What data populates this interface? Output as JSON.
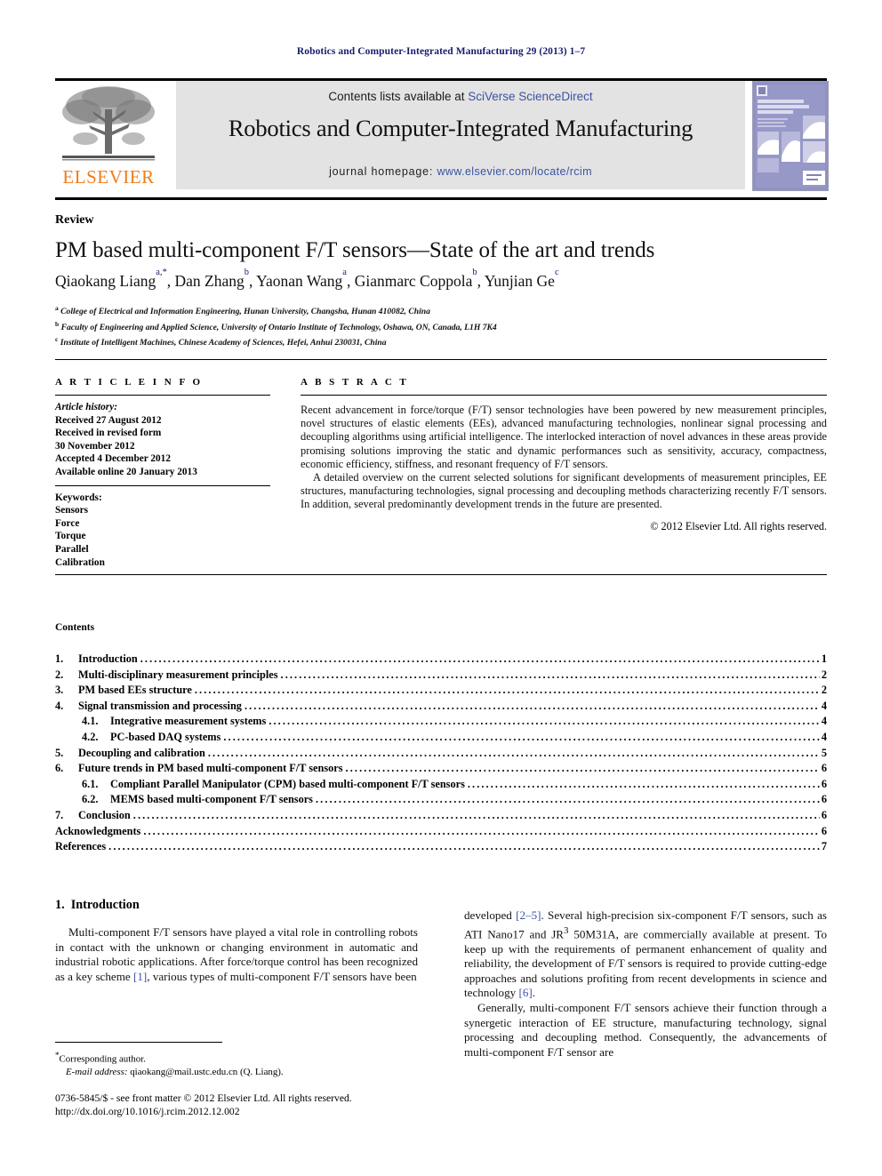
{
  "running_head": "Robotics and Computer-Integrated Manufacturing 29 (2013) 1–7",
  "masthead": {
    "contents_prefix": "Contents lists available at ",
    "sciencedirect": "SciVerse ScienceDirect",
    "journal_title": "Robotics and Computer-Integrated Manufacturing",
    "homepage_prefix": "journal homepage: ",
    "homepage_url": "www.elsevier.com/locate/rcim",
    "publisher": "ELSEVIER",
    "cover_title": "Robotics and Computer-Integrated Manufacturing",
    "accent_blue": "#3a53a4",
    "elsevier_orange": "#ef7d1a",
    "cover_purple": "#8e8fc0"
  },
  "article": {
    "type": "Review",
    "title": "PM based multi-component F/T sensors—State of the art and trends",
    "authors": [
      {
        "name": "Qiaokang Liang",
        "marks": "a,*"
      },
      {
        "name": "Dan Zhang",
        "marks": "b"
      },
      {
        "name": "Yaonan Wang",
        "marks": "a"
      },
      {
        "name": "Gianmarc Coppola",
        "marks": "b"
      },
      {
        "name": "Yunjian Ge",
        "marks": "c"
      }
    ],
    "affiliations": [
      {
        "mark": "a",
        "text": "College of Electrical and Information Engineering, Hunan University, Changsha, Hunan 410082, China"
      },
      {
        "mark": "b",
        "text": "Faculty of Engineering and Applied Science, University of Ontario Institute of Technology, Oshawa, ON, Canada, L1H 7K4"
      },
      {
        "mark": "c",
        "text": "Institute of Intelligent Machines, Chinese Academy of Sciences, Hefei, Anhui 230031, China"
      }
    ]
  },
  "article_info": {
    "heading": "A R T I C L E   I N F O",
    "history_label": "Article history:",
    "history": [
      "Received 27 August 2012",
      "Received in revised form",
      "30 November 2012",
      "Accepted 4 December 2012",
      "Available online 20 January 2013"
    ],
    "keywords_label": "Keywords:",
    "keywords": [
      "Sensors",
      "Force",
      "Torque",
      "Parallel",
      "Calibration"
    ]
  },
  "abstract": {
    "heading": "A B S T R A C T",
    "paragraphs": [
      "Recent advancement in force/torque (F/T) sensor technologies have been powered by new measurement principles, novel structures of elastic elements (EEs), advanced manufacturing technologies, nonlinear signal processing and decoupling algorithms using artificial intelligence. The interlocked interaction of novel advances in these areas provide promising solutions improving the static and dynamic performances such as sensitivity, accuracy, compactness, economic efficiency, stiffness, and resonant frequency of F/T sensors.",
      "A detailed overview on the current selected solutions for significant developments of measurement principles, EE structures, manufacturing technologies, signal processing and decoupling methods characterizing recently F/T sensors. In addition, several predominantly development trends in the future are presented."
    ],
    "copyright": "© 2012 Elsevier Ltd. All rights reserved."
  },
  "contents": {
    "heading": "Contents",
    "entries": [
      {
        "num": "1.",
        "label": "Introduction",
        "page": "1",
        "level": 0
      },
      {
        "num": "2.",
        "label": "Multi-disciplinary measurement principles",
        "page": "2",
        "level": 0
      },
      {
        "num": "3.",
        "label": "PM based EEs structure",
        "page": "2",
        "level": 0
      },
      {
        "num": "4.",
        "label": "Signal transmission and processing",
        "page": "4",
        "level": 0
      },
      {
        "num": "4.1.",
        "label": "Integrative measurement systems",
        "page": "4",
        "level": 1
      },
      {
        "num": "4.2.",
        "label": "PC-based DAQ systems",
        "page": "4",
        "level": 1
      },
      {
        "num": "5.",
        "label": "Decoupling and calibration",
        "page": "5",
        "level": 0
      },
      {
        "num": "6.",
        "label": "Future trends in PM based multi-component F/T sensors",
        "page": "6",
        "level": 0
      },
      {
        "num": "6.1.",
        "label": "Compliant Parallel Manipulator (CPM) based multi-component F/T sensors",
        "page": "6",
        "level": 1
      },
      {
        "num": "6.2.",
        "label": "MEMS based multi-component F/T sensors",
        "page": "6",
        "level": 1
      },
      {
        "num": "7.",
        "label": "Conclusion",
        "page": "6",
        "level": 0
      },
      {
        "num": "",
        "label": "Acknowledgments",
        "page": "6",
        "level": 0
      },
      {
        "num": "",
        "label": "References",
        "page": "7",
        "level": 0
      }
    ]
  },
  "body": {
    "section_number": "1.",
    "section_title": "Introduction",
    "left_paragraph_1": "Multi-component F/T sensors have played a vital role in controlling robots in contact with the unknown or changing environment in automatic and industrial robotic applications. After force/torque control has been recognized as a key scheme",
    "left_ref_1": "[1]",
    "left_paragraph_1_tail": ", various types of multi-component F/T sensors have been",
    "right_paragraph_1_head": "developed ",
    "right_ref_1": "[2–5]",
    "right_paragraph_1": ". Several high-precision six-component F/T sensors, such as ATI Nano17 and JR",
    "right_sup": "3",
    "right_paragraph_1b": " 50M31A, are commercially available at present. To keep up with the requirements of permanent enhancement of quality and reliability, the development of F/T sensors is required to provide cutting-edge approaches and solutions profiting from recent developments in science and technology ",
    "right_ref_2": "[6]",
    "right_paragraph_1c": ".",
    "right_paragraph_2": "Generally, multi-component F/T sensors achieve their function through a synergetic interaction of EE structure, manufacturing technology, signal processing and decoupling method. Consequently, the advancements of multi-component F/T sensor are"
  },
  "footer": {
    "corresponding_marker": "*",
    "corresponding_label": "Corresponding author.",
    "email_label": "E-mail address:",
    "email": "qiaokang@mail.ustc.edu.cn (Q. Liang).",
    "issn_line": "0736-5845/$ - see front matter © 2012 Elsevier Ltd. All rights reserved.",
    "doi_line": "http://dx.doi.org/10.1016/j.rcim.2012.12.002"
  }
}
